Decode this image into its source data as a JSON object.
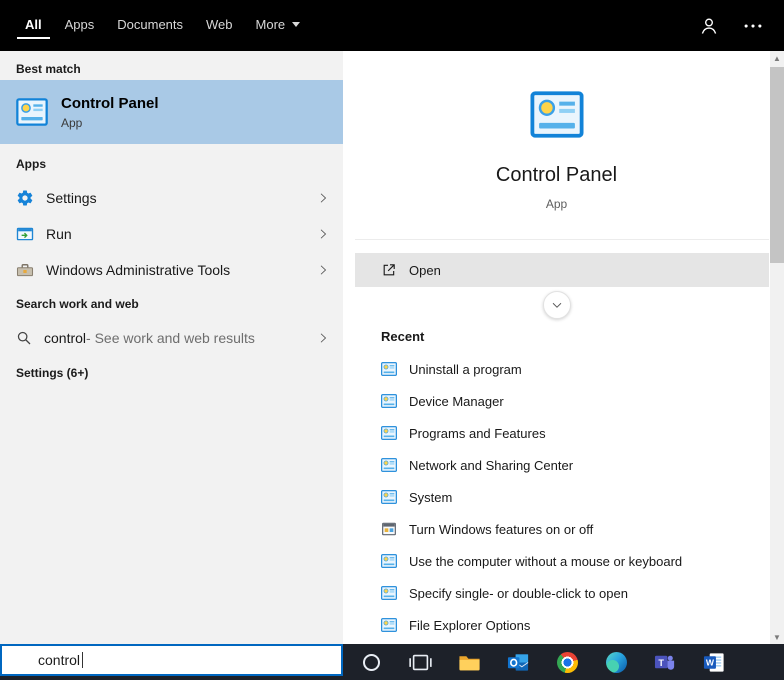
{
  "topbar": {
    "tabs": [
      {
        "label": "All"
      },
      {
        "label": "Apps"
      },
      {
        "label": "Documents"
      },
      {
        "label": "Web"
      },
      {
        "label": "More"
      }
    ],
    "right_icons": [
      "account-icon",
      "more-options-icon"
    ]
  },
  "left_panel": {
    "best_match_header": "Best match",
    "best_match": {
      "title": "Control Panel",
      "subtitle": "App"
    },
    "apps_header": "Apps",
    "app_items": [
      {
        "label": "Settings",
        "icon": "gear-icon"
      },
      {
        "label": "Run",
        "icon": "run-window-icon"
      },
      {
        "label": "Windows Administrative Tools",
        "icon": "toolbox-icon"
      }
    ],
    "search_header": "Search work and web",
    "web_search": {
      "query": "control",
      "suffix": " - See work and web results",
      "icon": "search-icon"
    },
    "settings_header": "Settings (6+)"
  },
  "preview": {
    "title": "Control Panel",
    "subtitle": "App",
    "open_label": "Open",
    "recent_header": "Recent",
    "recent_items": [
      {
        "label": "Uninstall a program"
      },
      {
        "label": "Device Manager"
      },
      {
        "label": "Programs and Features"
      },
      {
        "label": "Network and Sharing Center"
      },
      {
        "label": "System"
      },
      {
        "label": "Turn Windows features on or off"
      },
      {
        "label": "Use the computer without a mouse or keyboard"
      },
      {
        "label": "Specify single- or double-click to open"
      },
      {
        "label": "File Explorer Options"
      }
    ]
  },
  "taskbar": {
    "search_value": "control",
    "icons": [
      "cortana-icon",
      "task-view-icon",
      "file-explorer-icon",
      "outlook-icon",
      "chrome-icon",
      "edge-icon",
      "teams-icon",
      "word-icon"
    ]
  },
  "colors": {
    "accent": "#0078d7",
    "best_match_highlight": "#a9c9e6",
    "topbar_bg": "#000000",
    "left_panel_bg": "#f2f2f2",
    "open_row_bg": "#e5e5e5",
    "taskbar_bg": "#1d2129",
    "search_box_border": "#0067c0"
  }
}
